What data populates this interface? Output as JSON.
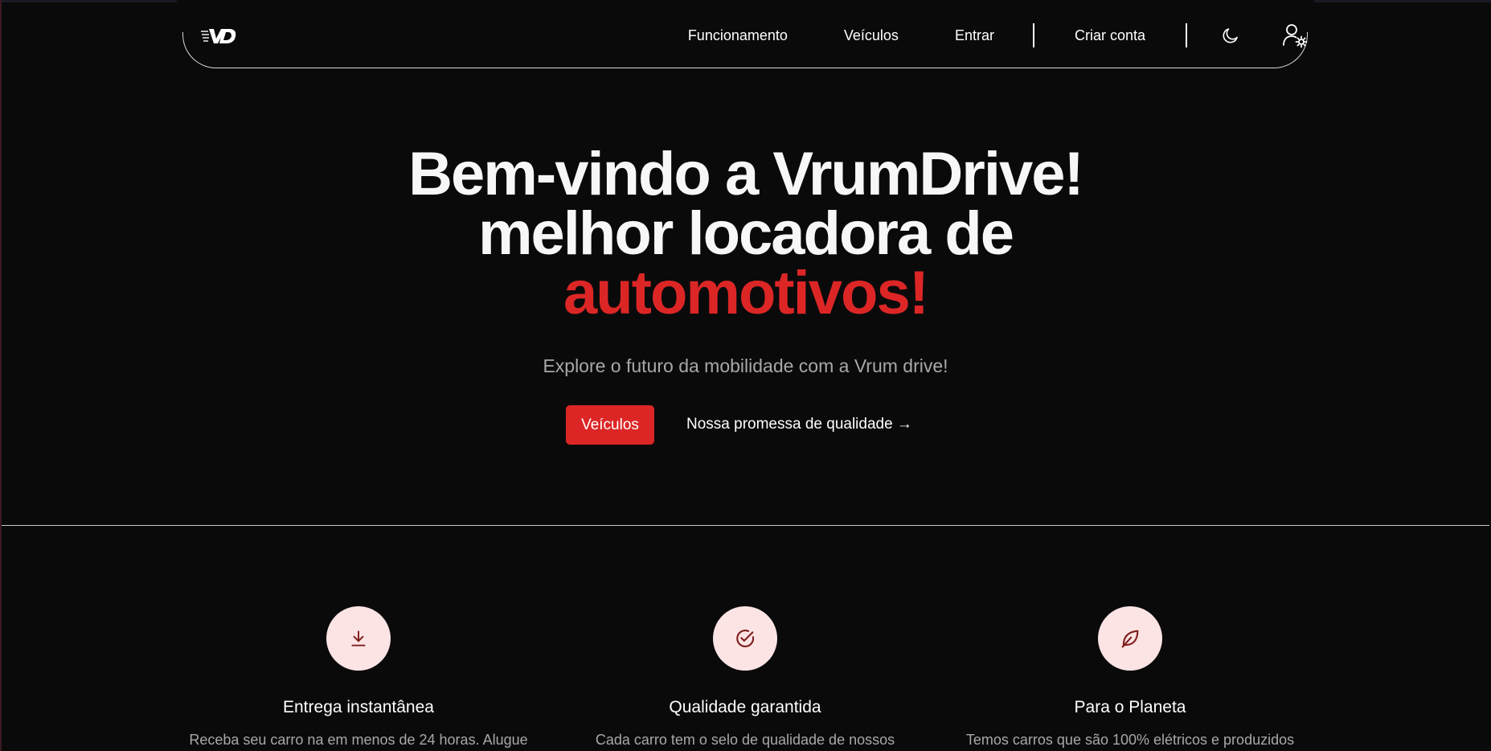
{
  "nav": {
    "logo_text": "VD",
    "links": [
      "Funcionamento",
      "Veículos",
      "Entrar",
      "Criar conta"
    ]
  },
  "hero": {
    "title_line1": "Bem-vindo a VrumDrive!",
    "title_line2": "melhor locadora de",
    "title_accent": "automotivos!",
    "subtitle": "Explore o futuro da mobilidade com a Vrum drive!",
    "primary_button": "Veículos",
    "secondary_link": "Nossa promessa de qualidade →"
  },
  "features": [
    {
      "icon": "download-icon",
      "title": "Entrega instantânea",
      "text": "Receba seu carro na em menos de 24 horas. Alugue"
    },
    {
      "icon": "check-circle-icon",
      "title": "Qualidade garantida",
      "text": "Cada carro tem o selo de qualidade de nossos"
    },
    {
      "icon": "leaf-icon",
      "title": "Para o Planeta",
      "text": "Temos carros que são 100% elétricos e produzidos"
    }
  ],
  "colors": {
    "background": "#0a0a0b",
    "accent": "#dc2626",
    "icon_bg": "#fde4e4",
    "icon_stroke": "#7f1d1d",
    "muted_text": "#a8a8a8"
  }
}
